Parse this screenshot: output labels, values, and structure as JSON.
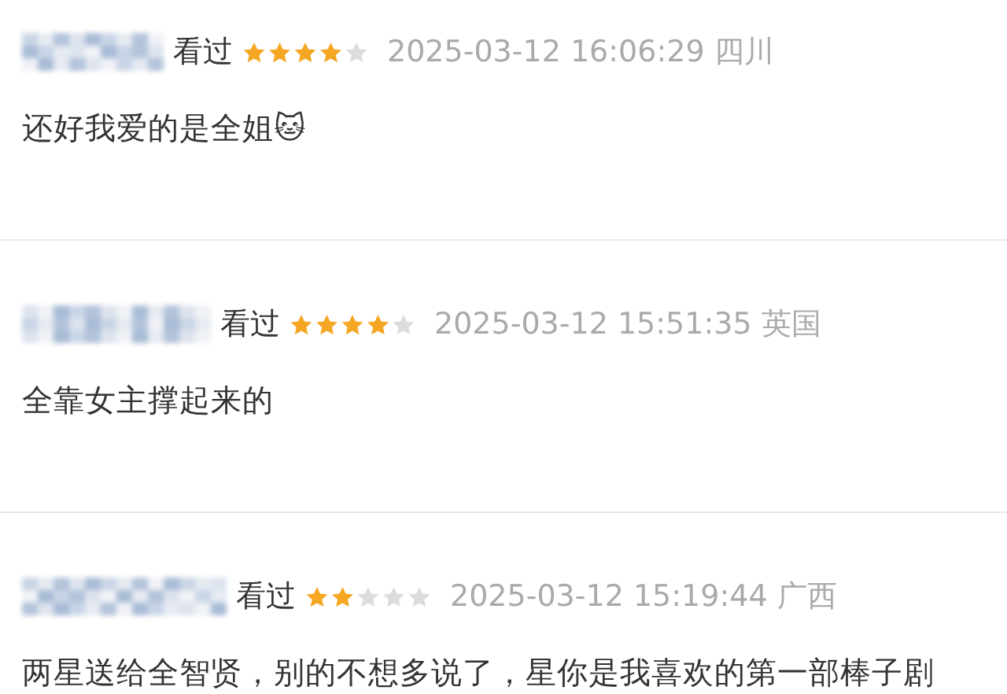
{
  "reviews": [
    {
      "status": "看过",
      "stars": 4,
      "time": "2025-03-12 16:06:29",
      "location": "四川",
      "comment": "还好我爱的是全姐🐱"
    },
    {
      "status": "看过",
      "stars": 4,
      "time": "2025-03-12 15:51:35",
      "location": "英国",
      "comment": "全靠女主撑起来的"
    },
    {
      "status": "看过",
      "stars": 2,
      "time": "2025-03-12 15:19:44",
      "location": "广西",
      "comment": "两星送给全智贤，别的不想多说了，星你是我喜欢的第一部棒子剧"
    }
  ]
}
